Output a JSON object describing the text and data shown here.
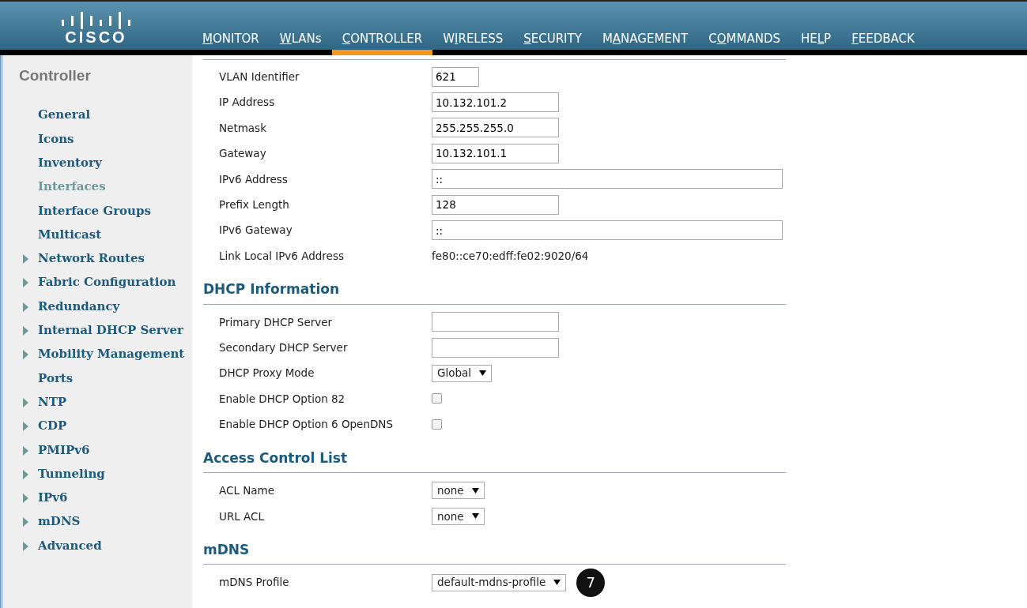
{
  "brand": {
    "name": "CISCO"
  },
  "nav": [
    {
      "key": "M",
      "after": "ONITOR",
      "selected": false
    },
    {
      "key": "W",
      "after": "LANs",
      "selected": false
    },
    {
      "key": "C",
      "after": "ONTROLLER",
      "selected": true
    },
    {
      "before": "W",
      "key": "I",
      "after": "RELESS",
      "selected": false
    },
    {
      "key": "S",
      "after": "ECURITY",
      "selected": false
    },
    {
      "before": "M",
      "key": "A",
      "after": "NAGEMENT",
      "selected": false
    },
    {
      "before": "C",
      "key": "O",
      "after": "MMANDS",
      "selected": false
    },
    {
      "before": "HE",
      "key": "L",
      "after": "P",
      "selected": false
    },
    {
      "key": "F",
      "after": "EEDBACK",
      "selected": false
    }
  ],
  "sidebar": {
    "title": "Controller",
    "items": [
      {
        "label": "General",
        "expandable": false,
        "selected": false
      },
      {
        "label": "Icons",
        "expandable": false,
        "selected": false
      },
      {
        "label": "Inventory",
        "expandable": false,
        "selected": false
      },
      {
        "label": "Interfaces",
        "expandable": false,
        "selected": true
      },
      {
        "label": "Interface Groups",
        "expandable": false,
        "selected": false
      },
      {
        "label": "Multicast",
        "expandable": false,
        "selected": false
      },
      {
        "label": "Network Routes",
        "expandable": true,
        "selected": false
      },
      {
        "label": "Fabric Configuration",
        "expandable": true,
        "selected": false
      },
      {
        "label": "Redundancy",
        "expandable": true,
        "selected": false
      },
      {
        "label": "Internal DHCP Server",
        "expandable": true,
        "selected": false
      },
      {
        "label": "Mobility Management",
        "expandable": true,
        "selected": false
      },
      {
        "label": "Ports",
        "expandable": false,
        "selected": false
      },
      {
        "label": "NTP",
        "expandable": true,
        "selected": false
      },
      {
        "label": "CDP",
        "expandable": true,
        "selected": false
      },
      {
        "label": "PMIPv6",
        "expandable": true,
        "selected": false
      },
      {
        "label": "Tunneling",
        "expandable": true,
        "selected": false
      },
      {
        "label": "IPv6",
        "expandable": true,
        "selected": false
      },
      {
        "label": "mDNS",
        "expandable": true,
        "selected": false
      },
      {
        "label": "Advanced",
        "expandable": true,
        "selected": false
      }
    ]
  },
  "sections": [
    {
      "rows": [
        {
          "label": "VLAN Identifier",
          "kind": "short-input",
          "value": "621"
        },
        {
          "label": "IP Address",
          "kind": "input",
          "value": "10.132.101.2"
        },
        {
          "label": "Netmask",
          "kind": "input",
          "value": "255.255.255.0"
        },
        {
          "label": "Gateway",
          "kind": "input",
          "value": "10.132.101.1"
        },
        {
          "label": "IPv6 Address",
          "kind": "long-input",
          "value": "::"
        },
        {
          "label": "Prefix Length",
          "kind": "input",
          "value": "128"
        },
        {
          "label": "IPv6 Gateway",
          "kind": "long-input",
          "value": "::"
        },
        {
          "label": "Link Local IPv6 Address",
          "kind": "static",
          "value": "fe80::ce70:edff:fe02:9020/64"
        }
      ]
    },
    {
      "title": "DHCP Information",
      "rows": [
        {
          "label": "Primary DHCP Server",
          "kind": "input",
          "value": ""
        },
        {
          "label": "Secondary DHCP Server",
          "kind": "input",
          "value": ""
        },
        {
          "label": "DHCP Proxy Mode",
          "kind": "select",
          "value": "Global"
        },
        {
          "label": "Enable DHCP Option 82",
          "kind": "checkbox",
          "checked": false
        },
        {
          "label": "Enable DHCP Option 6 OpenDNS",
          "kind": "checkbox",
          "checked": false
        }
      ]
    },
    {
      "title": "Access Control List",
      "rows": [
        {
          "label": "ACL Name",
          "kind": "select",
          "value": "none"
        },
        {
          "label": "URL ACL",
          "kind": "select",
          "value": "none"
        }
      ]
    },
    {
      "title": "mDNS",
      "rows": [
        {
          "label": "mDNS Profile",
          "kind": "select",
          "value": "default-mdns-profile",
          "callout": "7"
        }
      ]
    }
  ]
}
